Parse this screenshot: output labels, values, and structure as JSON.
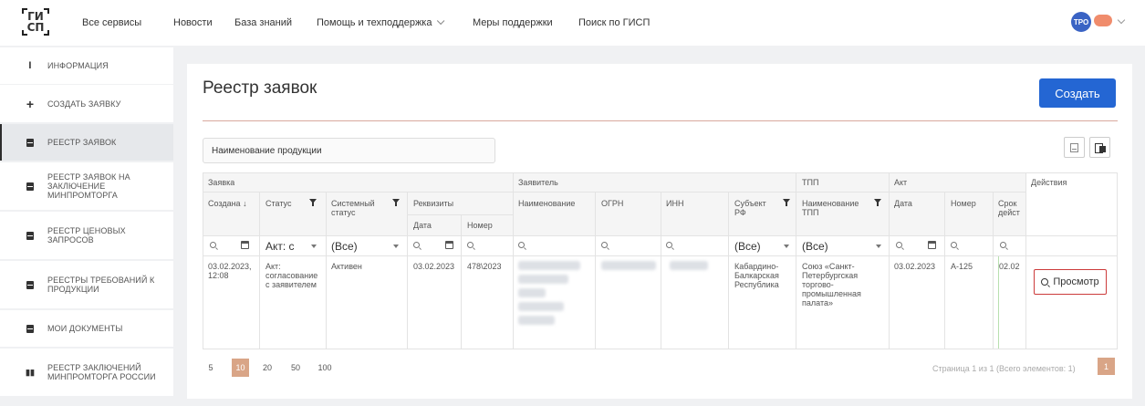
{
  "header": {
    "logo_line1": "ГИ",
    "logo_line2": "СП",
    "nav": [
      {
        "label": "Все сервисы"
      },
      {
        "label": "Новости"
      },
      {
        "label": "База знаний"
      },
      {
        "label": "Помощь и техподдержка"
      },
      {
        "label": "Меры поддержки"
      },
      {
        "label": "Поиск по ГИСП"
      }
    ],
    "avatar": "ТРО"
  },
  "sidebar": {
    "items": [
      {
        "label": "Информация",
        "icon": "info-icon"
      },
      {
        "label": "Создать заявку",
        "icon": "plus-icon"
      },
      {
        "label": "Реестр заявок",
        "icon": "document-icon",
        "active": true
      },
      {
        "label": "Реестр заявок на заключение Минпромторга",
        "icon": "document-icon"
      },
      {
        "label": "Реестр ценовых запросов",
        "icon": "document-icon"
      },
      {
        "label": "Реестры требований к продукции",
        "icon": "document-icon"
      },
      {
        "label": "Мои документы",
        "icon": "document-icon"
      },
      {
        "label": "Реестр заключений Минпромторга России",
        "icon": "books-icon"
      }
    ]
  },
  "main": {
    "title": "Реестр заявок",
    "create_label": "Создать",
    "search_value": "Наименование продукции",
    "table": {
      "groups": [
        "Заявка",
        "Заявитель",
        "ТПП",
        "Акт",
        "Действия"
      ],
      "headers": {
        "created": "Создана ↓",
        "status": "Статус",
        "system_status": "Системный статус",
        "requisites": "Реквизиты",
        "date": "Дата",
        "number": "Номер",
        "name": "Наименование",
        "ogrn": "ОГРН",
        "inn": "ИНН",
        "subject": "Субъект РФ",
        "tpp_name": "Наименование ТПП",
        "act_date": "Дата",
        "act_number": "Номер",
        "term": "Срок дейст"
      },
      "filters": {
        "status": "Акт: с",
        "system_status": "(Все)",
        "subject": "(Все)",
        "tpp": "(Все)"
      },
      "rows": [
        {
          "created": "03.02.2023, 12:08",
          "status": "Акт: согласование с заявителем",
          "system_status": "Активен",
          "date": "03.02.2023",
          "number": "478\\2023",
          "subject": "Кабардино-Балкарская Республика",
          "tpp": "Союз «Санкт-Петербургская торгово-промышленная палата»",
          "act_date": "03.02.2023",
          "act_number": "А-125",
          "term": "02.02"
        }
      ],
      "action_label": "Просмотр"
    },
    "pager": {
      "sizes": [
        "5",
        "10",
        "20",
        "50",
        "100"
      ],
      "active_size": "10",
      "info": "Страница 1 из 1 (Всего элементов: 1)",
      "current_page": "1"
    }
  }
}
